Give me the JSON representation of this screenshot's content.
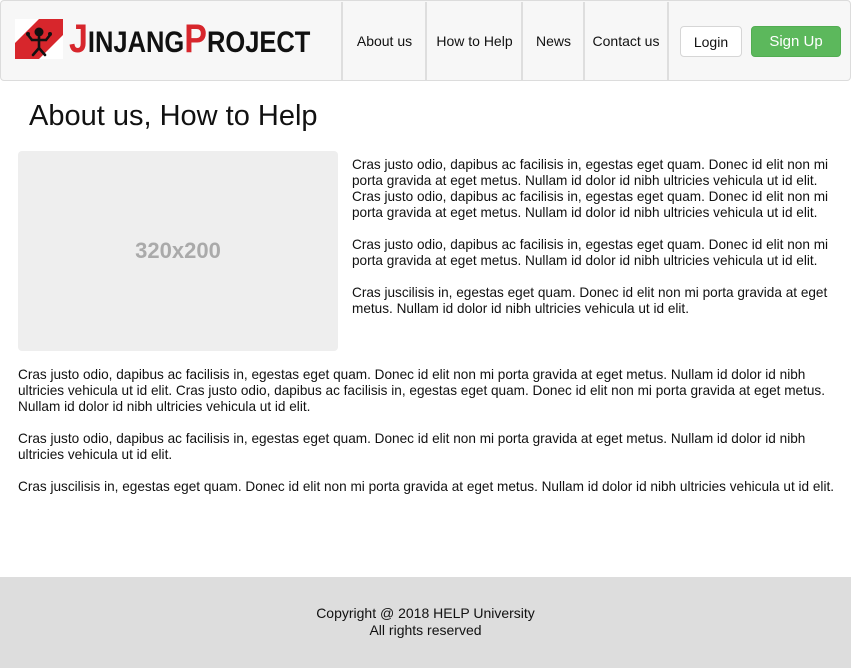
{
  "brand": {
    "logo_icon": "jinjang-logo-icon",
    "name_part1_initial": "J",
    "name_part1_rest": "INJANG",
    "name_part2_initial": "P",
    "name_part2_rest": "ROJECT",
    "accent_color": "#d7262c"
  },
  "nav": {
    "items": [
      {
        "label": "About us"
      },
      {
        "label": "How to Help"
      },
      {
        "label": "News"
      },
      {
        "label": "Contact us"
      }
    ],
    "login_label": "Login",
    "signup_label": "Sign Up",
    "signup_color": "#5cb85c"
  },
  "main": {
    "title": "About us, How to Help",
    "image_placeholder": "320x200",
    "side_paragraphs": [
      "Cras justo odio, dapibus ac facilisis in, egestas eget quam. Donec id elit non mi porta gravida at eget metus. Nullam id dolor id nibh ultricies vehicula ut id elit. Cras justo odio, dapibus ac facilisis in, egestas eget quam. Donec id elit non mi porta gravida at eget metus. Nullam id dolor id nibh ultricies vehicula ut id elit.",
      "Cras justo odio, dapibus ac facilisis in, egestas eget quam. Donec id elit non mi porta gravida at eget metus. Nullam id dolor id nibh ultricies vehicula ut id elit.",
      "Cras juscilisis in, egestas eget quam. Donec id elit non mi porta gravida at eget metus. Nullam id dolor id nibh ultricies vehicula ut id elit."
    ],
    "full_paragraphs": [
      "Cras justo odio, dapibus ac facilisis in, egestas eget quam. Donec id elit non mi porta gravida at eget metus. Nullam id dolor id nibh ultricies vehicula ut id elit. Cras justo odio, dapibus ac facilisis in, egestas eget quam. Donec id elit non mi porta gravida at eget metus. Nullam id dolor id nibh ultricies vehicula ut id elit.",
      "Cras justo odio, dapibus ac facilisis in, egestas eget quam. Donec id elit non mi porta gravida at eget metus. Nullam id dolor id nibh ultricies vehicula ut id elit.",
      "Cras juscilisis in, egestas eget quam. Donec id elit non mi porta gravida at eget metus. Nullam id dolor id nibh ultricies vehicula ut id elit."
    ]
  },
  "footer": {
    "copyright": "Copyright @ 2018 HELP University",
    "rights": "All rights reserved"
  }
}
